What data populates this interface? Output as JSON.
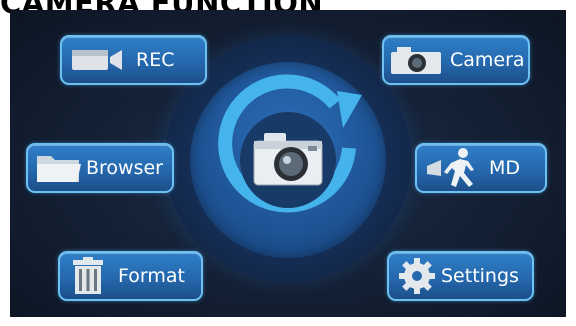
{
  "page": {
    "title": "CAMERA FUNCTION"
  },
  "menu": {
    "rec": {
      "label": "REC",
      "icon": "video-camera-icon"
    },
    "camera": {
      "label": "Camera",
      "icon": "photo-camera-icon"
    },
    "browser": {
      "label": "Browser",
      "icon": "folder-icon"
    },
    "md": {
      "label": "MD",
      "icon": "motion-person-icon"
    },
    "format": {
      "label": "Format",
      "icon": "trash-can-icon"
    },
    "settings": {
      "label": "Settings",
      "icon": "gear-icon"
    }
  },
  "center": {
    "icon": "photo-camera-icon",
    "mode": "Camera"
  },
  "colors": {
    "button": "#2568ad",
    "button_border": "#6cc1f2",
    "background": "#152237",
    "dial": "#1f5597",
    "dial_ring": "#46b4ec"
  }
}
